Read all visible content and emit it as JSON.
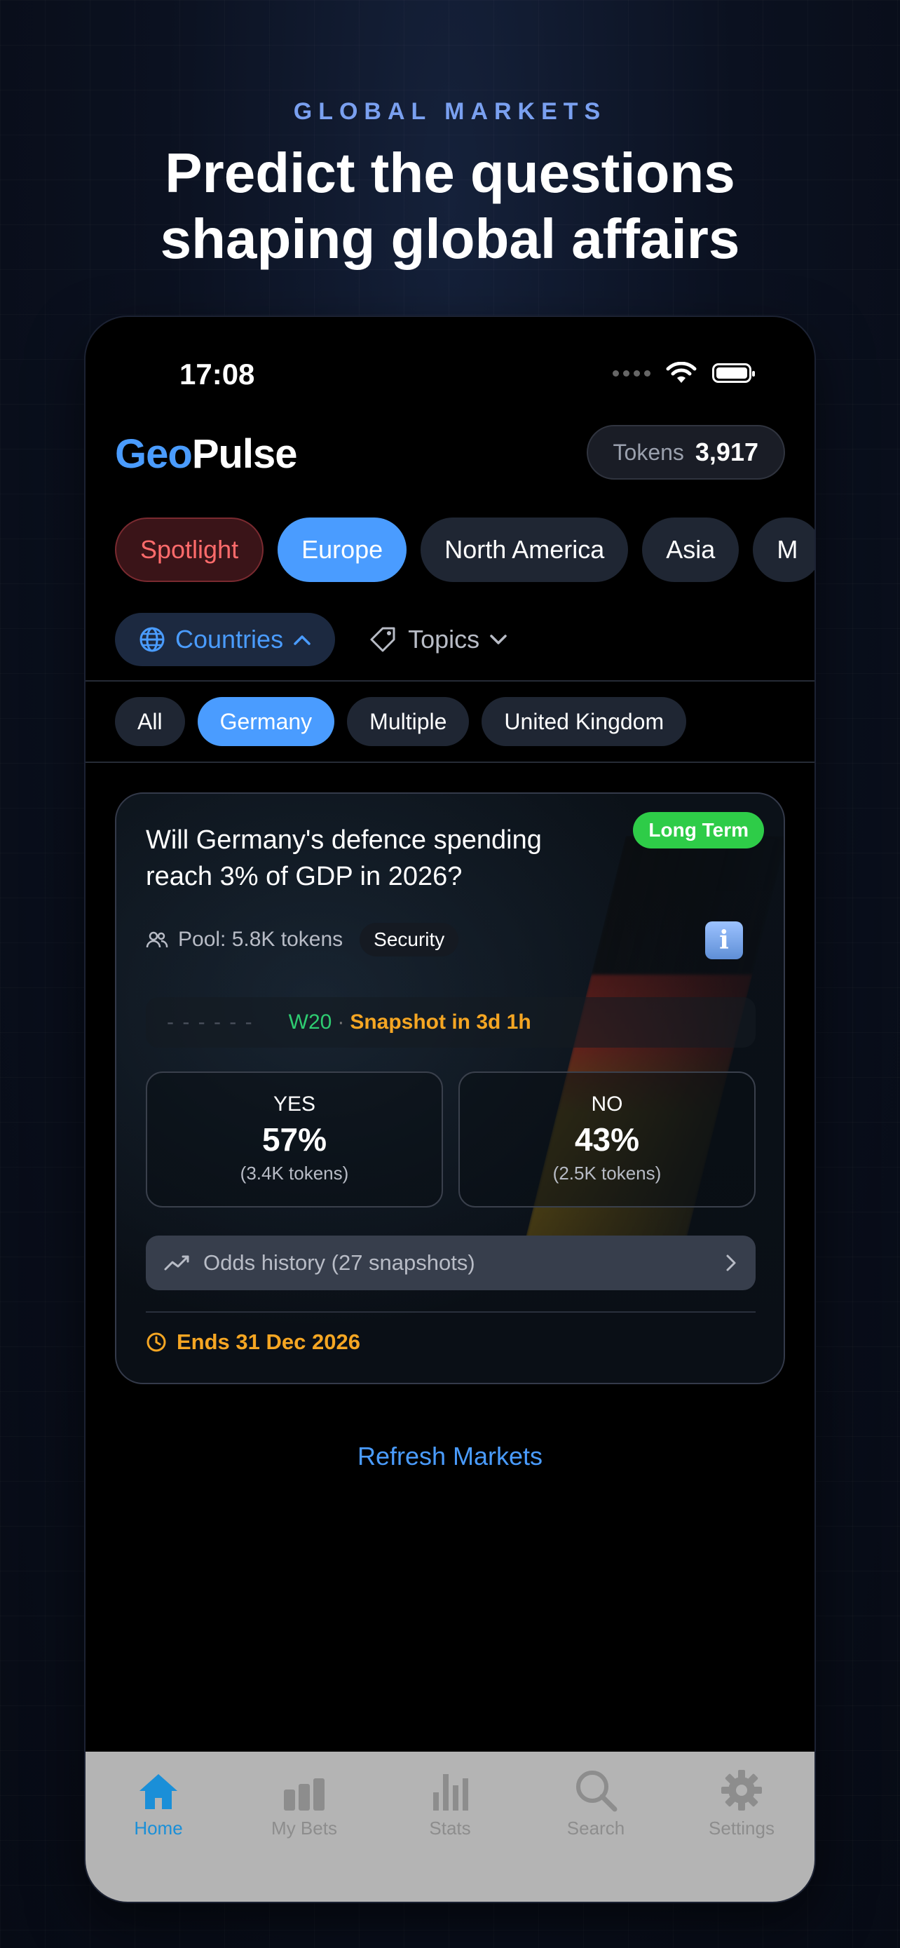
{
  "promo": {
    "eyebrow": "GLOBAL MARKETS",
    "headline_line1": "Predict the questions",
    "headline_line2": "shaping global affairs"
  },
  "status_bar": {
    "time": "17:08"
  },
  "header": {
    "logo_part1": "Geo",
    "logo_part2": "Pulse",
    "tokens_label": "Tokens",
    "tokens_value": "3,917"
  },
  "regions": [
    "Spotlight",
    "Europe",
    "North America",
    "Asia",
    "M"
  ],
  "filters": {
    "countries": "Countries",
    "topics": "Topics"
  },
  "countries": [
    "All",
    "Germany",
    "Multiple",
    "United Kingdom"
  ],
  "market": {
    "badge": "Long Term",
    "question": "Will Germany's defence spending reach 3% of GDP in 2026?",
    "pool": "Pool: 5.8K tokens",
    "tag": "Security",
    "info_icon": "i",
    "snapshot_week": "W20",
    "snapshot_sep": "·",
    "snapshot_text": "Snapshot in 3d 1h",
    "yes": {
      "label": "YES",
      "pct": "57%",
      "tokens": "(3.4K tokens)"
    },
    "no": {
      "label": "NO",
      "pct": "43%",
      "tokens": "(2.5K tokens)"
    },
    "odds_history": "Odds history (27 snapshots)",
    "ends": "Ends 31 Dec 2026"
  },
  "refresh": "Refresh Markets",
  "tabs": [
    "Home",
    "My Bets",
    "Stats",
    "Search",
    "Settings"
  ],
  "colors": {
    "accent": "#4a9cff",
    "long_term": "#2ecc48",
    "warning": "#f5a623",
    "spotlight": "#ff6b6b",
    "tab_active": "#1a8fd8"
  }
}
